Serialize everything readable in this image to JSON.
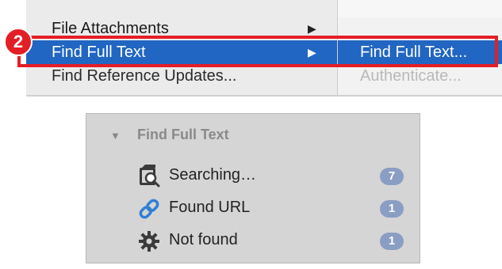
{
  "menu": {
    "items": [
      {
        "label": "File Attachments",
        "arrow": "▶"
      },
      {
        "label": "Find Full Text",
        "arrow": "▶"
      },
      {
        "label": "Find Reference Updates..."
      }
    ],
    "submenu": {
      "items": [
        {
          "label": "Find Full Text..."
        },
        {
          "label": "Authenticate..."
        }
      ]
    },
    "step_badge": "2",
    "colors": {
      "selected": "#2066c2",
      "highlight": "#e41e26"
    }
  },
  "sidebar": {
    "group_title": "Find Full Text",
    "rows": [
      {
        "label": "Searching…",
        "count": "7",
        "icon": "search-document-icon"
      },
      {
        "label": "Found URL",
        "count": "1",
        "icon": "link-icon"
      },
      {
        "label": "Not found",
        "count": "1",
        "icon": "gear-icon"
      }
    ],
    "colors": {
      "badge": "#8a9ec3",
      "panel": "#d5d5d5"
    }
  }
}
